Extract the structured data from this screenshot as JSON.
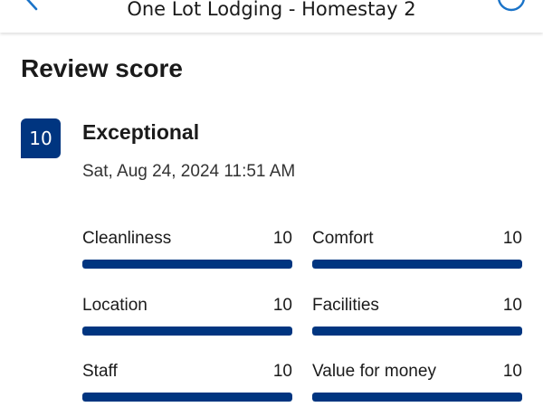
{
  "header": {
    "title": "One Lot Lodging - Homestay 2",
    "back_icon": "back-arrow-icon",
    "share_icon": "share-icon"
  },
  "review": {
    "section_title": "Review score",
    "score": "10",
    "label": "Exceptional",
    "date": "Sat, Aug 24, 2024 11:51 AM",
    "categories": [
      {
        "label": "Cleanliness",
        "value": "10",
        "fill": 1.0
      },
      {
        "label": "Comfort",
        "value": "10",
        "fill": 1.0
      },
      {
        "label": "Location",
        "value": "10",
        "fill": 1.0
      },
      {
        "label": "Facilities",
        "value": "10",
        "fill": 1.0
      },
      {
        "label": "Staff",
        "value": "10",
        "fill": 1.0
      },
      {
        "label": "Value for money",
        "value": "10",
        "fill": 1.0
      }
    ]
  },
  "colors": {
    "brand": "#003580",
    "track": "#e6e6e6"
  }
}
